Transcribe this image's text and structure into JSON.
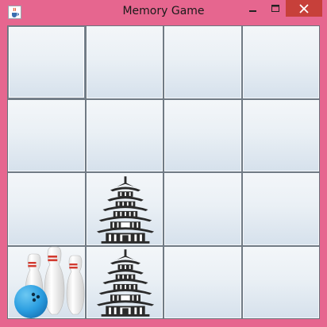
{
  "window": {
    "title": "Memory Game",
    "frame_color": "#e6668f",
    "close_color": "#c7403a"
  },
  "titlebar": {
    "icon": "java-cup-icon",
    "controls": [
      "minimize-icon",
      "maximize-icon",
      "close-icon"
    ]
  },
  "board": {
    "rows": 4,
    "cols": 4,
    "cards": [
      [
        "hidden-selected",
        "hidden",
        "hidden",
        "hidden"
      ],
      [
        "hidden",
        "hidden",
        "hidden",
        "hidden"
      ],
      [
        "hidden",
        "pagoda",
        "hidden",
        "hidden"
      ],
      [
        "bowling",
        "pagoda",
        "hidden",
        "hidden"
      ]
    ]
  }
}
